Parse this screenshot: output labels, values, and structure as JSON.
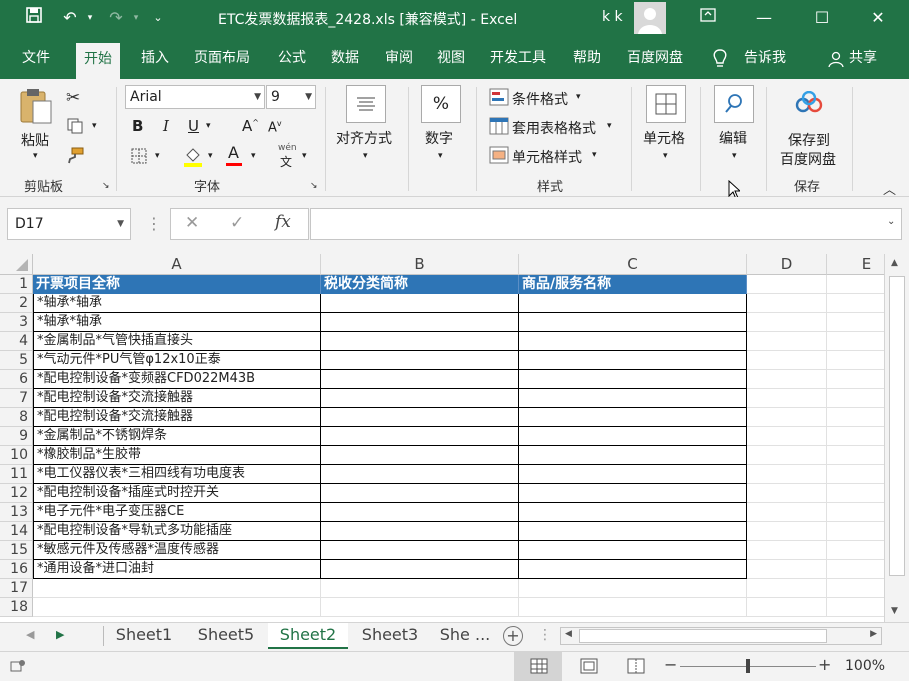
{
  "window": {
    "title": "ETC发票数据报表_2428.xls  [兼容模式]  -  Excel",
    "user": "k k"
  },
  "tabs": [
    "文件",
    "开始",
    "插入",
    "页面布局",
    "公式",
    "数据",
    "审阅",
    "视图",
    "开发工具",
    "帮助",
    "百度网盘",
    "告诉我",
    "共享"
  ],
  "active_tab": "开始",
  "ribbon": {
    "clipboard": {
      "paste": "粘贴",
      "label": "剪贴板"
    },
    "font": {
      "name": "Arial",
      "size": "9",
      "label": "字体",
      "pinyin": "wén"
    },
    "alignment": {
      "label": "对齐方式"
    },
    "number": {
      "label": "数字",
      "symbol": "%"
    },
    "styles": {
      "conditional": "条件格式",
      "table": "套用表格格式",
      "cell": "单元格样式",
      "label": "样式"
    },
    "cells": {
      "label": "单元格"
    },
    "editing": {
      "label": "编辑"
    },
    "save": {
      "label_line1": "保存到",
      "label_line2": "百度网盘",
      "group": "保存"
    }
  },
  "formula_bar": {
    "name_box": "D17",
    "value": ""
  },
  "columns": [
    "A",
    "B",
    "C",
    "D",
    "E"
  ],
  "row_numbers": [
    "1",
    "2",
    "3",
    "4",
    "5",
    "6",
    "7",
    "8",
    "9",
    "10",
    "11",
    "12",
    "13",
    "14",
    "15",
    "16",
    "17",
    "18"
  ],
  "headers": [
    "开票项目全称",
    "税收分类简称",
    "商品/服务名称"
  ],
  "rows": [
    "*轴承*轴承",
    "*轴承*轴承",
    "*金属制品*气管快插直接头",
    "*气动元件*PU气管φ12x10正泰",
    "*配电控制设备*变频器CFD022M43B",
    "*配电控制设备*交流接触器",
    "*配电控制设备*交流接触器",
    "*金属制品*不锈钢焊条",
    "*橡胶制品*生胶带",
    "*电工仪器仪表*三相四线有功电度表",
    "*配电控制设备*插座式时控开关",
    "*电子元件*电子变压器CE",
    "*配电控制设备*导轨式多功能插座",
    "*敏感元件及传感器*温度传感器",
    "*通用设备*进口油封"
  ],
  "sheets": [
    "Sheet1",
    "Sheet5",
    "Sheet2",
    "Sheet3",
    "She ..."
  ],
  "active_sheet": "Sheet2",
  "status": {
    "zoom": "100%",
    "zoom_level": 0.5
  },
  "colors": {
    "brand": "#217346",
    "header_fill": "#2e75b6"
  }
}
